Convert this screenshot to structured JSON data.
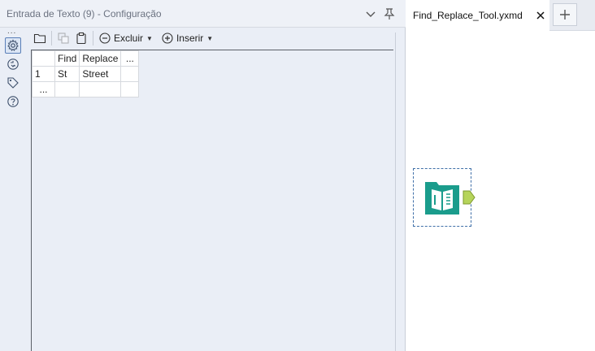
{
  "panel": {
    "title": "Entrada de Texto (9) - Configuração"
  },
  "rail": {
    "dots": "...",
    "items": [
      {
        "icon": "gear-icon",
        "active": true
      },
      {
        "icon": "connection-icon",
        "active": false
      },
      {
        "icon": "tag-icon",
        "active": false
      },
      {
        "icon": "help-icon",
        "active": false
      }
    ]
  },
  "toolbar": {
    "delete_label": "Excluir",
    "insert_label": "Inserir"
  },
  "grid": {
    "headers": [
      "",
      "Find",
      "Replace",
      "..."
    ],
    "rows": [
      [
        "1",
        "St",
        "Street",
        ""
      ],
      [
        "...",
        "",
        "",
        ""
      ]
    ]
  },
  "canvas": {
    "tab_label": "Find_Replace_Tool.yxmd",
    "colors": {
      "tool_teal": "#1a9c8c",
      "anchor_green": "#b6d45a",
      "selection": "#3f6fa8"
    }
  }
}
